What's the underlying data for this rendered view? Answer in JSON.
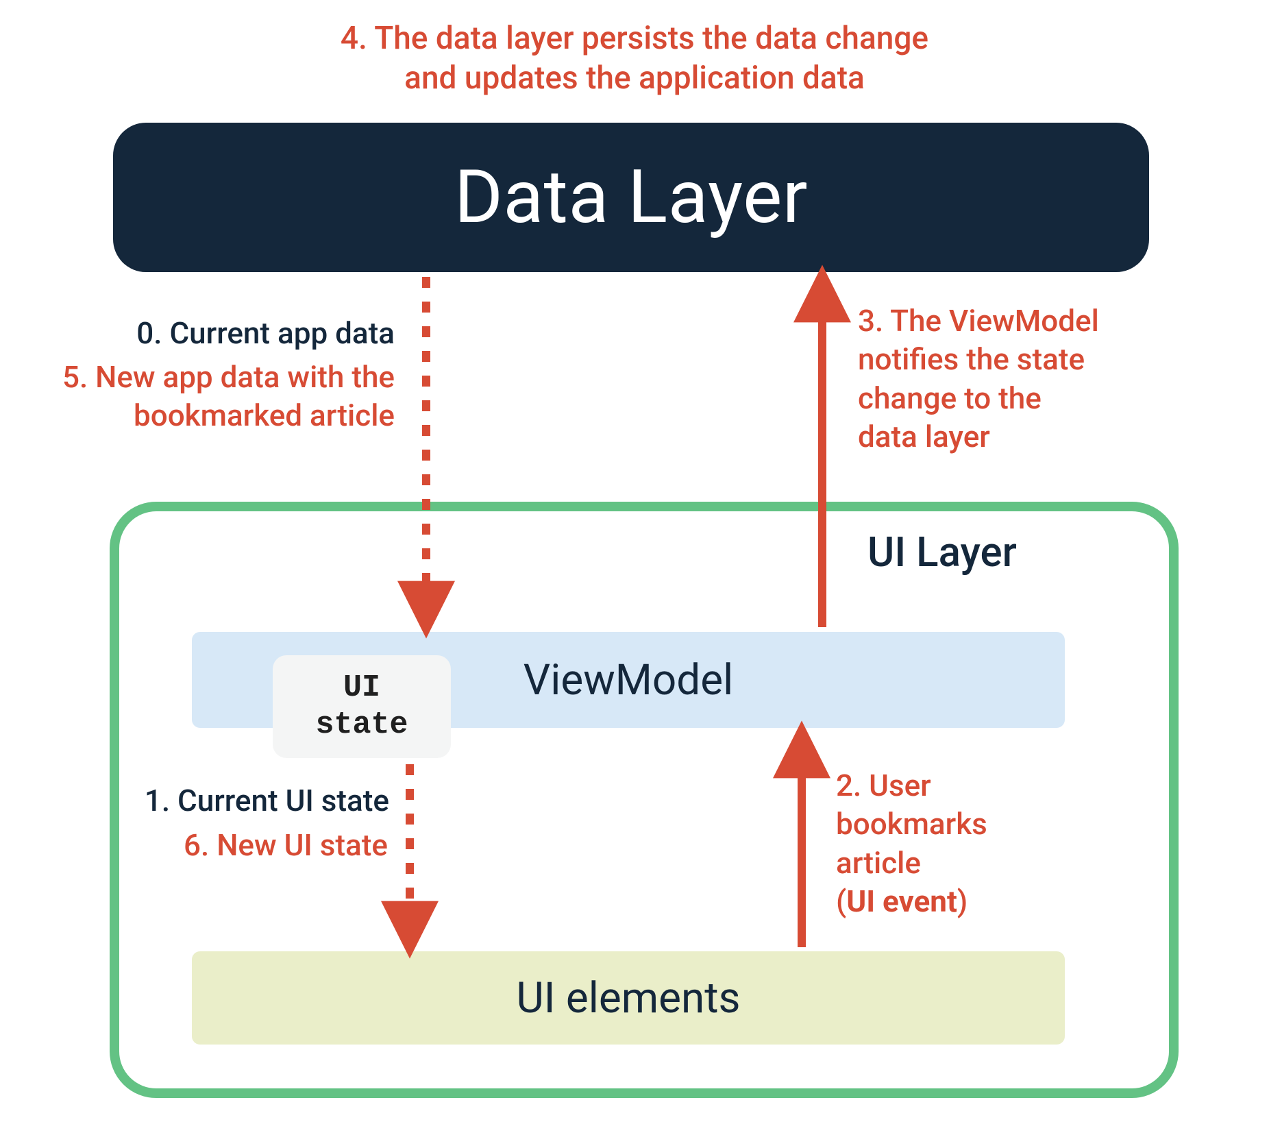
{
  "colors": {
    "red": "#d74b34",
    "dark": "#14273b",
    "green": "#63c284",
    "lightblue": "#d7e8f7",
    "cream": "#eaeec9",
    "gray": "#f4f5f5"
  },
  "boxes": {
    "data_layer": "Data Layer",
    "ui_layer_label": "UI Layer",
    "viewmodel": "ViewModel",
    "ui_state": "UI state",
    "ui_elements": "UI elements"
  },
  "captions": {
    "top_line1": "4. The data layer persists the data change",
    "top_line2": "and updates the application data"
  },
  "annotations": {
    "n0": "0. Current app data",
    "n5_l1": "5. New app data with the",
    "n5_l2": "bookmarked article",
    "n3_l1": "3. The ViewModel",
    "n3_l2": "notifies the state",
    "n3_l3": "change to the",
    "n3_l4": "data layer",
    "n1": "1. Current UI state",
    "n6": "6. New UI state",
    "n2_l1": "2. User",
    "n2_l2": "bookmarks",
    "n2_l3": "article",
    "n2_l4a": "(",
    "n2_l4b": "UI event",
    "n2_l4c": ")"
  }
}
